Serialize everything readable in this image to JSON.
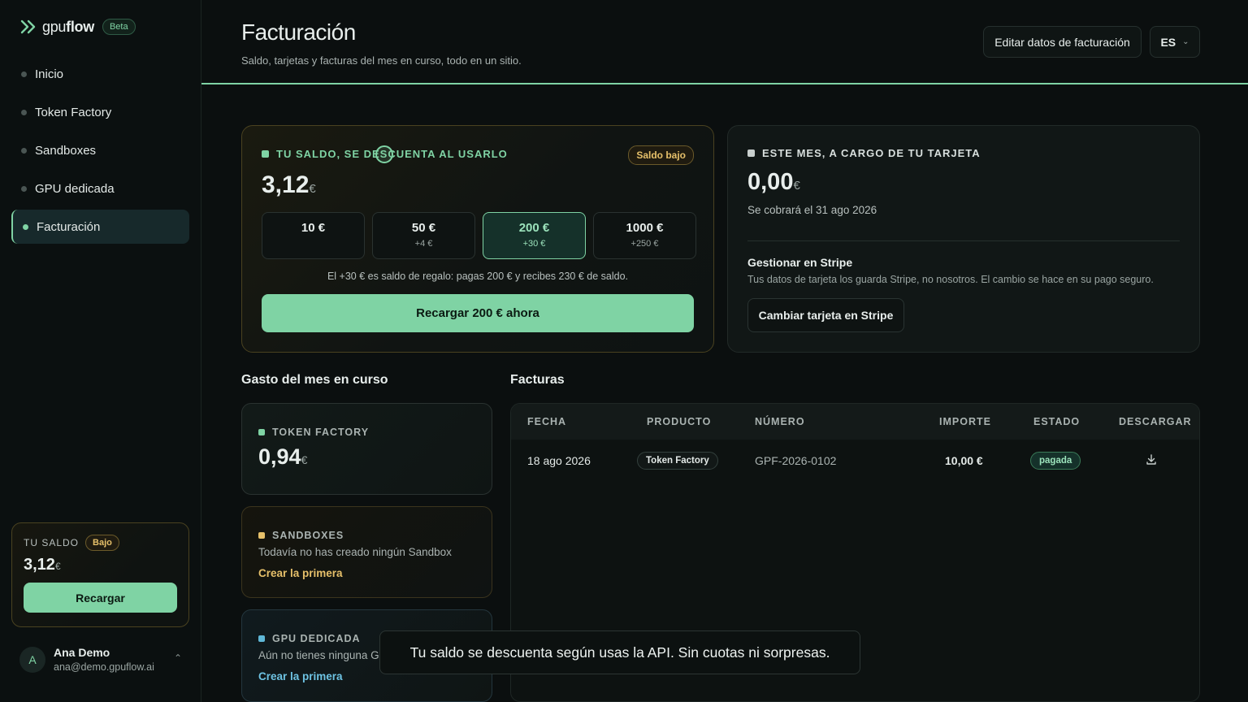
{
  "brand": {
    "name_prefix": "gpu",
    "name_suffix": "flow",
    "badge": "Beta"
  },
  "nav": {
    "items": [
      {
        "label": "Inicio"
      },
      {
        "label": "Token Factory"
      },
      {
        "label": "Sandboxes"
      },
      {
        "label": "GPU dedicada"
      },
      {
        "label": "Facturación",
        "active": true
      }
    ]
  },
  "sidebar_balance": {
    "label": "TU SALDO",
    "badge": "Bajo",
    "amount": "3,12",
    "currency": "€",
    "button": "Recargar"
  },
  "user": {
    "initial": "A",
    "name": "Ana Demo",
    "email": "ana@demo.gpuflow.ai"
  },
  "header": {
    "title": "Facturación",
    "subtitle": "Saldo, tarjetas y facturas del mes en curso, todo en un sitio.",
    "edit_button": "Editar datos de facturación",
    "language": "ES"
  },
  "balance_card": {
    "heading": "TU SALDO, SE DESCUENTA AL USARLO",
    "badge": "Saldo bajo",
    "amount": "3,12",
    "currency": "€",
    "options": [
      {
        "value": "10 €",
        "bonus": ""
      },
      {
        "value": "50 €",
        "bonus": "+4 €"
      },
      {
        "value": "200 €",
        "bonus": "+30 €",
        "selected": true
      },
      {
        "value": "1000 €",
        "bonus": "+250 €"
      }
    ],
    "note": "El +30 € es saldo de regalo: pagas 200 € y recibes 230 € de saldo.",
    "button": "Recargar 200 € ahora"
  },
  "card_month": {
    "heading": "ESTE MES, A CARGO DE TU TARJETA",
    "amount": "0,00",
    "currency": "€",
    "charge_date": "Se cobrará el 31 ago 2026",
    "stripe_title": "Gestionar en Stripe",
    "stripe_desc": "Tus datos de tarjeta los guarda Stripe, no nosotros. El cambio se hace en su pago seguro.",
    "stripe_button": "Cambiar tarjeta en Stripe"
  },
  "spend": {
    "title": "Gasto del mes en curso",
    "token_factory": {
      "label": "TOKEN FACTORY",
      "amount": "0,94",
      "currency": "€"
    },
    "sandboxes": {
      "label": "SANDBOXES",
      "empty": "Todavía no has creado ningún Sandbox",
      "link": "Crear la primera"
    },
    "gpu": {
      "label": "GPU DEDICADA",
      "empty": "Aún no tienes ninguna GPU",
      "link": "Crear la primera"
    }
  },
  "invoices": {
    "title": "Facturas",
    "columns": [
      "FECHA",
      "PRODUCTO",
      "NÚMERO",
      "IMPORTE",
      "ESTADO",
      "DESCARGAR"
    ],
    "rows": [
      {
        "date": "18 ago 2026",
        "product": "Token Factory",
        "number": "GPF-2026-0102",
        "amount": "10,00 €",
        "status": "pagada"
      }
    ]
  },
  "toast": {
    "message": "Tu saldo se descuenta según usas la API. Sin cuotas ni sorpresas."
  },
  "colors": {
    "accent": "#7fd3a4",
    "warning": "#e6c06a",
    "gpu": "#5fb7d6",
    "background": "#0b0f0f"
  },
  "icons": {
    "logo": "double-chevron-right-icon",
    "download": "download-icon",
    "chevron": "chevron-down-icon"
  }
}
